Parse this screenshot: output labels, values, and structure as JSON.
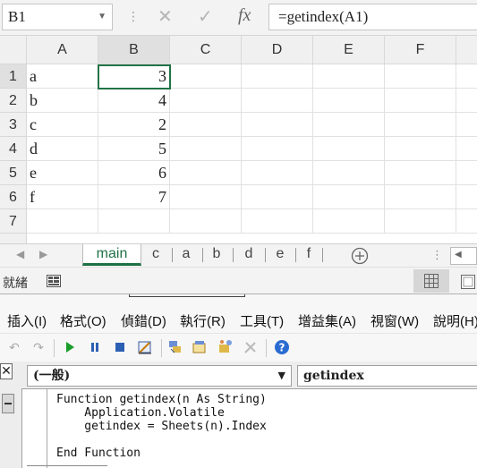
{
  "formula_bar": {
    "name_box": "B1",
    "cancel_glyph": "✕",
    "enter_glyph": "✓",
    "fx_glyph": "fx",
    "formula": "=getindex(A1)"
  },
  "grid": {
    "columns": [
      "A",
      "B",
      "C",
      "D",
      "E",
      "F"
    ],
    "rows": [
      {
        "num": "1",
        "a": "a",
        "b": "3"
      },
      {
        "num": "2",
        "a": "b",
        "b": "4"
      },
      {
        "num": "3",
        "a": "c",
        "b": "2"
      },
      {
        "num": "4",
        "a": "d",
        "b": "5"
      },
      {
        "num": "5",
        "a": "e",
        "b": "6"
      },
      {
        "num": "6",
        "a": "f",
        "b": "7"
      },
      {
        "num": "7",
        "a": "",
        "b": ""
      }
    ]
  },
  "sheet_tabs": {
    "active": "main",
    "tabs": [
      "main",
      "c",
      "a",
      "b",
      "d",
      "e",
      "f"
    ]
  },
  "status_bar": {
    "ready": "就緒"
  },
  "vbe": {
    "menu": [
      "插入(I)",
      "格式(O)",
      "偵錯(D)",
      "執行(R)",
      "工具(T)",
      "增益集(A)",
      "視窗(W)",
      "說明(H)"
    ],
    "object_combo": "(一般)",
    "procedure_combo": "getindex",
    "code_lines": [
      "Function getindex(n As String)",
      "    Application.Volatile",
      "    getindex = Sheets(n).Index",
      "",
      "End Function"
    ]
  },
  "colors": {
    "active_tab": "#1e7145",
    "run_green": "#1a9c2a",
    "pause_blue": "#2b5fb3",
    "help_blue": "#2a6bd1"
  }
}
